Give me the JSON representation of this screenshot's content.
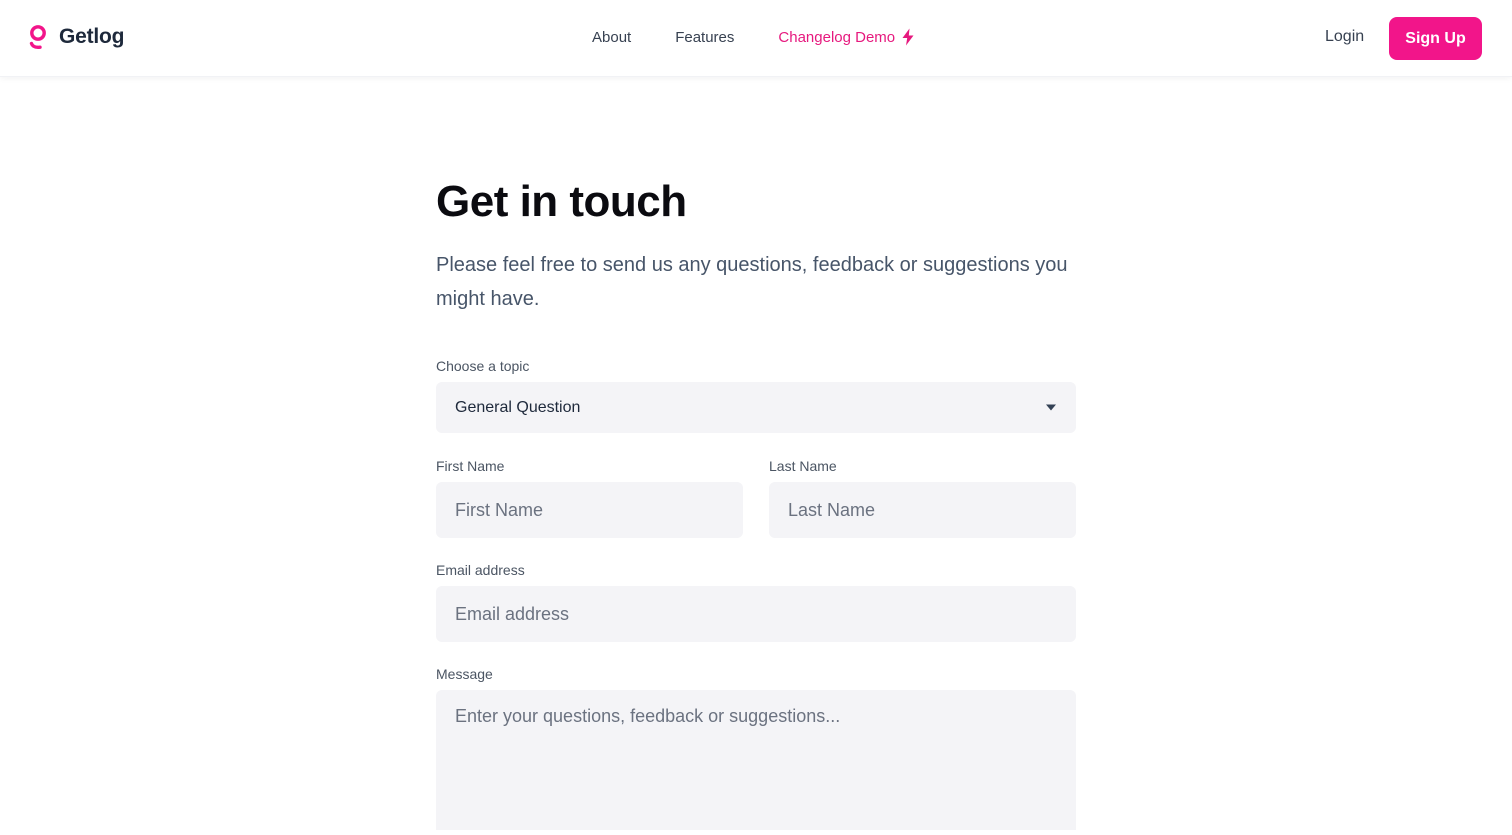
{
  "header": {
    "brand": "Getlog",
    "nav": {
      "about": "About",
      "features": "Features",
      "changelog_demo": "Changelog Demo"
    },
    "login": "Login",
    "signup": "Sign Up"
  },
  "colors": {
    "accent": "#f2158a",
    "accent_text": "#e6197e",
    "field_bg": "#f4f4f7"
  },
  "icons": {
    "logo": "getlog-logo-icon",
    "changelog": "lightning-bolt-icon",
    "select": "caret-down-icon"
  },
  "main": {
    "title": "Get in touch",
    "subtitle": "Please feel free to send us any questions, feedback or suggestions you might have.",
    "topic": {
      "label": "Choose a topic",
      "selected": "General Question"
    },
    "first_name": {
      "label": "First Name",
      "placeholder": "First Name"
    },
    "last_name": {
      "label": "Last Name",
      "placeholder": "Last Name"
    },
    "email": {
      "label": "Email address",
      "placeholder": "Email address"
    },
    "message": {
      "label": "Message",
      "placeholder": "Enter your questions, feedback or suggestions..."
    }
  }
}
